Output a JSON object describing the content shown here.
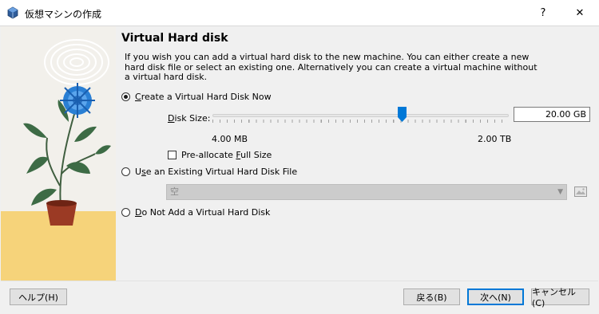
{
  "window": {
    "title": "仮想マシンの作成",
    "help_glyph": "?",
    "close_glyph": "✕"
  },
  "page": {
    "heading": "Virtual Hard disk",
    "description": "If you wish you can add a virtual hard disk to the new machine. You can either create a new hard disk file or select an existing one. Alternatively you can create a virtual machine without a virtual hard disk."
  },
  "options": {
    "create": {
      "prefix": "",
      "mnemonic": "C",
      "suffix": "reate a Virtual Hard Disk Now",
      "selected": true
    },
    "existing": {
      "prefix": "U",
      "mnemonic": "s",
      "suffix": "e an Existing Virtual Hard Disk File",
      "selected": false
    },
    "none": {
      "prefix": "",
      "mnemonic": "D",
      "suffix": "o Not Add a Virtual Hard Disk",
      "selected": false
    }
  },
  "disk_size": {
    "label_mnemonic": "D",
    "label_rest": "isk Size:",
    "value": "20.00 GB",
    "min_label": "4.00 MB",
    "max_label": "2.00 TB",
    "slider_fraction": 0.64
  },
  "preallocate": {
    "prefix": "Pre-allocate ",
    "mnemonic": "F",
    "suffix": "ull Size",
    "checked": false
  },
  "existing_file_combo": {
    "value": "空"
  },
  "buttons": {
    "help": "ヘルプ(H)",
    "back": "戻る(B)",
    "next": "次へ(N)",
    "cancel": "キャンセル(C)"
  },
  "icons": {
    "app": "virtualbox-icon",
    "folder": "folder-open-icon",
    "combo_arrow": "chevron-down-icon"
  },
  "colors": {
    "accent": "#0078d7",
    "art_yellow": "#f6d37a",
    "flower_blue": "#2a7fd4",
    "pot": "#9b3a24"
  }
}
